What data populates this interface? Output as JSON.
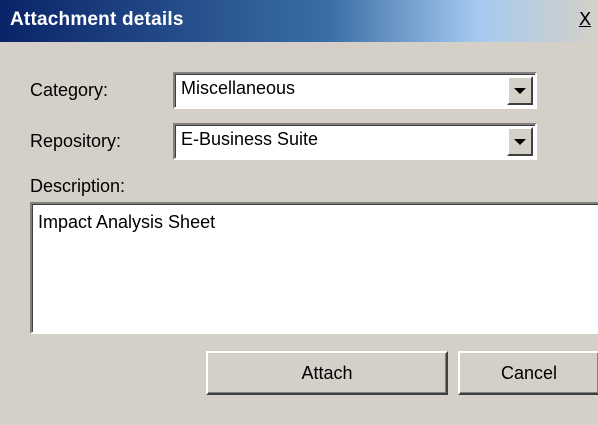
{
  "dialog": {
    "title": "Attachment details",
    "close_glyph": "X"
  },
  "form": {
    "category_label": "Category:",
    "category_value": "Miscellaneous",
    "repository_label": "Repository:",
    "repository_value": "E-Business Suite",
    "description_label": "Description:",
    "description_value": "Impact Analysis Sheet"
  },
  "buttons": {
    "attach_label": "Attach",
    "cancel_label": "Cancel"
  },
  "colors": {
    "title_bar_start": "#0a246a",
    "title_bar_end": "#d4d0c8",
    "dialog_face": "#d4d0c8"
  },
  "icons": {
    "close": "close-icon",
    "dropdown": "chevron-down-icon"
  }
}
